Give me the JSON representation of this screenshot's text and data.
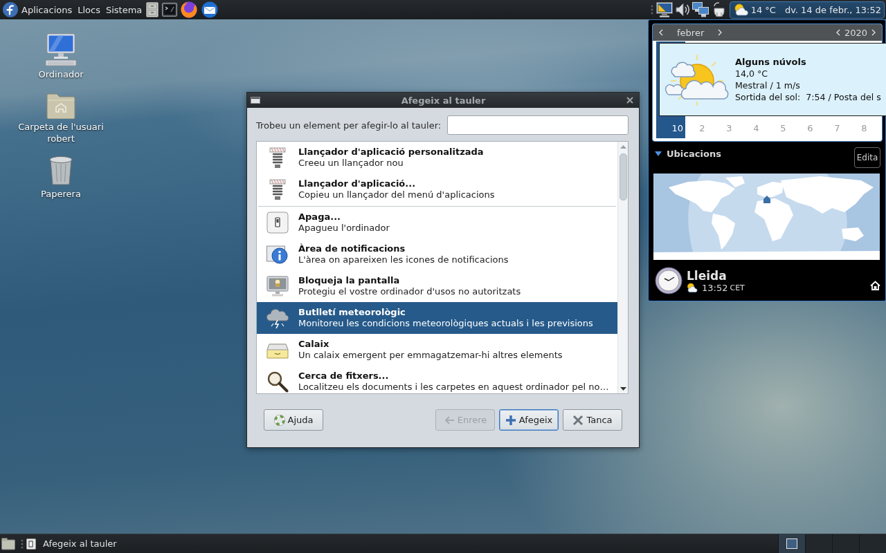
{
  "top_panel": {
    "menus": [
      {
        "label": "Aplicacions"
      },
      {
        "label": "Llocs"
      },
      {
        "label": "Sistema"
      }
    ],
    "clock": {
      "temperature": "14 °C",
      "datetime": "dv. 14 de febr., 13:52",
      "expanded": true
    }
  },
  "desktop_icons": [
    {
      "kind": "computer",
      "label": "Ordinador"
    },
    {
      "kind": "home-folder",
      "label": "Carpeta de l'usuari robert"
    },
    {
      "kind": "trash",
      "label": "Paperera"
    }
  ],
  "dialog": {
    "title": "Afegeix al tauler",
    "search": {
      "label": "Trobeu un element per afegir-lo al tauler:"
    },
    "item_groups": [
      {
        "items": [
          {
            "kind": "launcher",
            "title": "Llançador d'aplicació personalitzada",
            "description": "Creeu un llançador nou",
            "selected": false
          },
          {
            "kind": "launcher",
            "title": "Llançador d'aplicació...",
            "description": "Copieu un llançador del menú d'aplicacions",
            "selected": false
          }
        ]
      },
      {
        "items": [
          {
            "kind": "shutdown",
            "title": "Apaga...",
            "description": "Apagueu l'ordinador",
            "selected": false
          },
          {
            "kind": "notification-area",
            "title": "Àrea de notificacions",
            "description": "L'àrea on apareixen les icones de notificacions",
            "selected": false
          },
          {
            "kind": "lock-screen",
            "title": "Bloqueja la pantalla",
            "description": "Protegiu el vostre ordinador d'usos no autoritzats",
            "selected": false
          },
          {
            "kind": "weather",
            "title": "Butlletí meteorològic",
            "description": "Monitoreu les condicions meteorològiques actuals i les previsions",
            "selected": true
          },
          {
            "kind": "drawer",
            "title": "Calaix",
            "description": "Un calaix emergent per emmagatzemar-hi altres elements",
            "selected": false
          },
          {
            "kind": "search",
            "title": "Cerca de fitxers...",
            "description": "Localitzeu els documents i les carpetes en aquest ordinador pel no…",
            "selected": false
          }
        ]
      }
    ],
    "buttons": [
      {
        "kind": "help",
        "label": "Ajuda",
        "disabled": false,
        "focused": false
      },
      {
        "kind": "back",
        "label": "Enrere",
        "disabled": true,
        "focused": false
      },
      {
        "kind": "add",
        "label": "Afegeix",
        "disabled": false,
        "focused": true
      },
      {
        "kind": "close",
        "label": "Tanca",
        "disabled": false,
        "focused": false
      }
    ]
  },
  "calendar_popup": {
    "month": "febrer",
    "year": "2020",
    "weeks": [
      {
        "week": "10",
        "days": [
          {
            "label": "2",
            "other_month": true
          },
          {
            "label": "3",
            "other_month": true
          },
          {
            "label": "4",
            "other_month": true
          },
          {
            "label": "5",
            "other_month": true
          },
          {
            "label": "6",
            "other_month": true
          },
          {
            "label": "7",
            "other_month": true
          },
          {
            "label": "8",
            "other_month": true
          }
        ]
      }
    ],
    "weather_tooltip": {
      "condition": "Alguns núvols",
      "temperature": "14,0 °C",
      "wind": "Mestral / 1 m/s",
      "sun": "Sortida del sol:  7:54 / Posta del s"
    },
    "locations": {
      "heading": "Ubicacions",
      "expanded": true,
      "edit_button": "Edita",
      "entries": [
        {
          "city": "Lleida",
          "time": "13:52",
          "timezone": "CET",
          "home": true
        }
      ]
    }
  },
  "bottom_panel": {
    "tasks": [
      {
        "title": "Afegeix al tauler",
        "selected": false
      }
    ],
    "workspaces": [
      {
        "selected": true,
        "has_window": true
      },
      {
        "selected": false,
        "has_window": false
      },
      {
        "selected": false,
        "has_window": false
      },
      {
        "selected": false,
        "has_window": false
      }
    ]
  }
}
